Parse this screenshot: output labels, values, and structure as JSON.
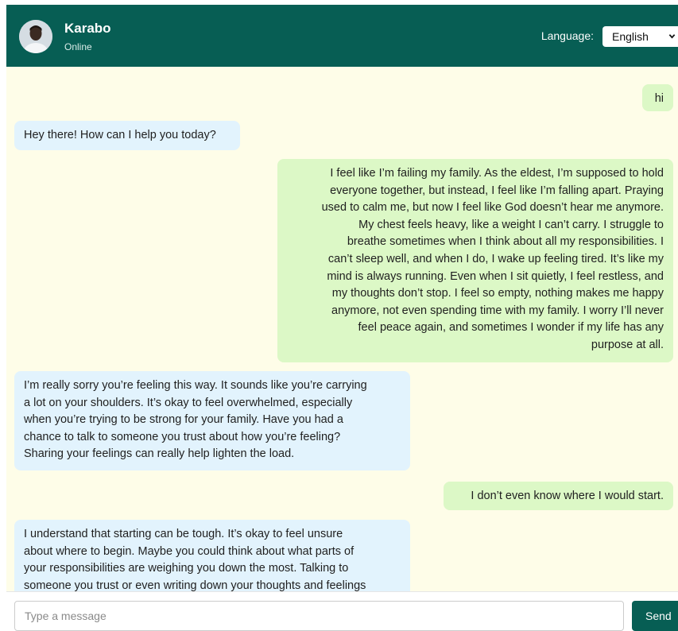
{
  "header": {
    "contact_name": "Karabo",
    "status": "Online",
    "avatar_icon": "person-avatar-icon",
    "language_label": "Language:",
    "language_selected": "English"
  },
  "messages": [
    {
      "sender": "user",
      "text": "hi"
    },
    {
      "sender": "bot",
      "text": "Hey there! How can I help you today?"
    },
    {
      "sender": "user",
      "lines": [
        "I feel like I’m failing my family. As the eldest, I’m supposed to hold",
        "everyone together, but instead, I feel like I’m falling apart. Praying",
        "used to calm me, but now I feel like God doesn’t hear me anymore.",
        "My chest feels heavy, like a weight I can’t carry. I struggle to",
        "breathe sometimes when I think about all my responsibilities. I",
        "can’t sleep well, and when I do, I wake up feeling tired. It’s like my",
        "mind is always running. Even when I sit quietly, I feel restless, and",
        "my thoughts don’t stop. I feel so empty, nothing makes me happy",
        "anymore, not even spending time with my family. I worry I’ll never",
        "feel peace again, and sometimes I wonder if my life has any",
        "purpose at all."
      ]
    },
    {
      "sender": "bot",
      "lines": [
        "I’m really sorry you’re feeling this way. It sounds like you’re carrying",
        "a lot on your shoulders. It’s okay to feel overwhelmed, especially",
        "when you’re trying to be strong for your family. Have you had a",
        "chance to talk to someone you trust about how you’re feeling?",
        "Sharing your feelings can really help lighten the load."
      ]
    },
    {
      "sender": "user",
      "text": "I don’t even know where I would start."
    },
    {
      "sender": "bot",
      "lines": [
        "I understand that starting can be tough. It’s okay to feel unsure",
        "about where to begin. Maybe you could think about what parts of",
        "your responsibilities are weighing you down the most. Talking to",
        "someone you trust or even writing down your thoughts and feelings"
      ]
    }
  ],
  "composer": {
    "placeholder": "Type a message",
    "send_label": "Send"
  },
  "colors": {
    "header_bg": "#075e54",
    "chat_bg": "#fefde8",
    "user_bubble": "#dcf8c6",
    "bot_bubble": "#e2f3fd",
    "send_button": "#075e54"
  }
}
